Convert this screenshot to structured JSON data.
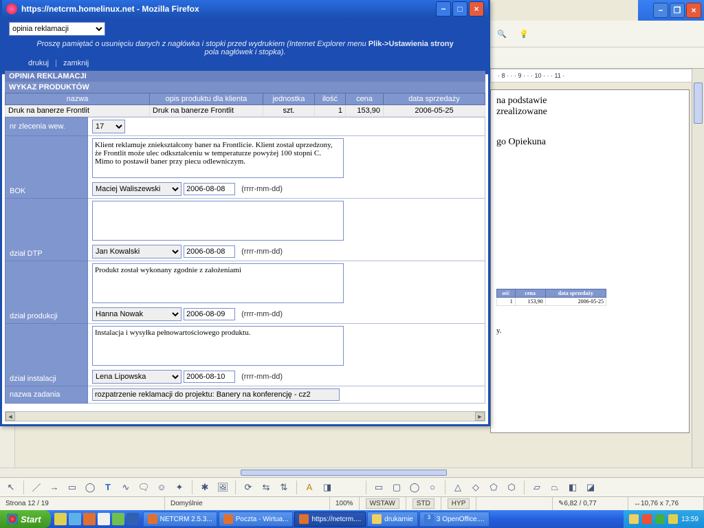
{
  "back_window": {
    "ruler": "· 8 · · · 9 · · · 10 · · · 11 ·",
    "doc_line1": "na podstawie",
    "doc_line2": "zrealizowane",
    "doc_line3": "go Opiekuna",
    "small_table": {
      "headers": [
        "ość",
        "cena",
        "data sprzedaży"
      ],
      "row": [
        "1",
        "153,90",
        "2006-05-25"
      ]
    },
    "doc_micro": "y."
  },
  "ff": {
    "title": "https://netcrm.homelinux.net - Mozilla Firefox",
    "select": "opinia reklamacji",
    "hint_pre": "Proszę pamiętać o usunięciu danych z nagłówka i stopki przed wydrukiem (Internet Explorer menu ",
    "hint_b1": "Plik->Ustawienia strony",
    "hint_mid": " pola ",
    "hint_i1": "nagłówek",
    "hint_mid2": " i ",
    "hint_i2": "stopka",
    "hint_post": ").",
    "link_print": "drukuj",
    "link_close": "zamknij",
    "h1": "OPINIA REKLAMACJI",
    "h2": "WYKAZ PRODUKTÓW",
    "prod_headers": [
      "nazwa",
      "opis produktu dla klienta",
      "jednostka",
      "ilość",
      "cena",
      "data sprzedaży"
    ],
    "prod_row": [
      "Druk na banerze Frontlit",
      "Druk na banerze Frontlit",
      "szt.",
      "1",
      "153,90",
      "2006-05-25"
    ],
    "row_nr_label": "nr zlecenia wew.",
    "row_nr_value": "17",
    "date_hint": "(rrrr-mm-dd)",
    "sections": [
      {
        "label": "BOK",
        "text": "Klient reklamuje zniekształcony baner na Frontlicie. Klient został uprzedzony, że Frontlit może ulec odkształceniu w temperaturze powyżej 100 stopni C. Mimo to postawił baner przy piecu odlewniczym.",
        "person": "Maciej Waliszewski",
        "date": "2006-08-08"
      },
      {
        "label": "dział DTP",
        "text": "",
        "person": "Jan Kowalski",
        "date": "2006-08-08"
      },
      {
        "label": "dział produkcji",
        "text": "Produkt został wykonany zgodnie z założeniami",
        "person": "Hanna Nowak",
        "date": "2006-08-09"
      },
      {
        "label": "dział instalacji",
        "text": "Instalacja i wysyłka pełnowartościowego produktu.",
        "person": "Lena Lipowska",
        "date": "2006-08-10"
      }
    ],
    "task_label": "nazwa zadania",
    "task_value": "rozpatrzenie reklamacji do projektu: Banery na konferencję - cz2"
  },
  "status": {
    "page": "Strona  12 / 19",
    "style": "Domyślnie",
    "zoom": "100%",
    "ins": "WSTAW",
    "std": "STD",
    "hyp": "HYP",
    "pos": "6,82 / 0,77",
    "size": "10,76 x 7,76"
  },
  "taskbar": {
    "start": "Start",
    "items": [
      "NETCRM 2.5.3...",
      "Poczta - Wirtua...",
      "https://netcrm....",
      "drukarnie",
      "3 OpenOffice...."
    ],
    "time": "13:59"
  }
}
